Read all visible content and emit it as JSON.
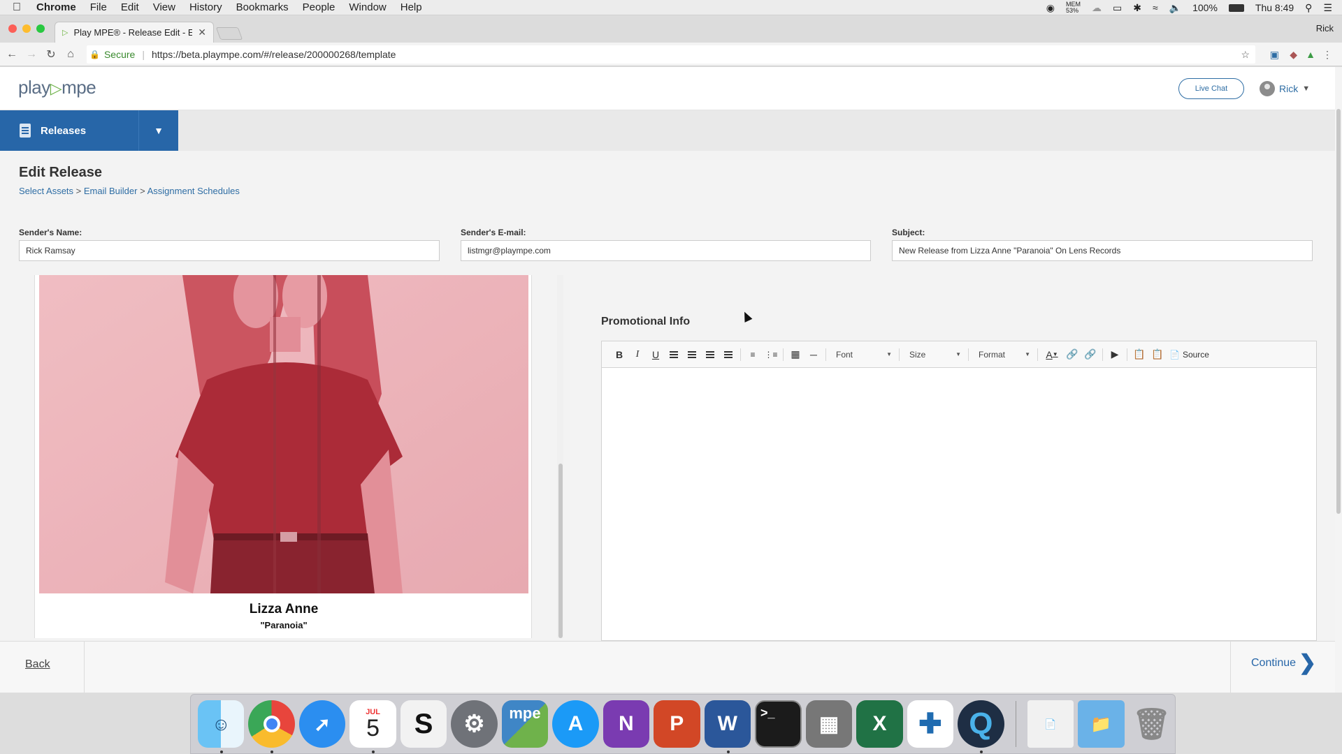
{
  "menubar": {
    "app": "Chrome",
    "items": [
      "File",
      "Edit",
      "View",
      "History",
      "Bookmarks",
      "People",
      "Window",
      "Help"
    ],
    "mem_label": "MEM",
    "mem_value": "53%",
    "battery": "100%",
    "clock": "Thu 8:49"
  },
  "browser": {
    "tab_title": "Play MPE® - Release Edit - Em",
    "profile_name": "Rick",
    "secure_label": "Secure",
    "url": "https://beta.plaympe.com/#/release/200000268/template"
  },
  "app": {
    "logo_play": "play",
    "logo_mpe": "mpe",
    "live_chat": "Live Chat",
    "user_name": "Rick",
    "nav_releases": "Releases"
  },
  "page": {
    "title": "Edit Release",
    "breadcrumbs": [
      "Select Assets",
      "Email Builder",
      "Assignment Schedules"
    ],
    "sep": ">"
  },
  "form": {
    "sender_name_label": "Sender's Name:",
    "sender_name_value": "Rick Ramsay",
    "sender_email_label": "Sender's E-mail:",
    "sender_email_value": "listmgr@plaympe.com",
    "subject_label": "Subject:",
    "subject_value": "New Release from Lizza Anne \"Paranoia\" On Lens Records"
  },
  "preview": {
    "artist": "Lizza Anne",
    "song": "\"Paranoia\""
  },
  "editor": {
    "section_title": "Promotional Info",
    "bold": "B",
    "italic": "I",
    "underline": "U",
    "font_label": "Font",
    "size_label": "Size",
    "format_label": "Format",
    "text_color": "A",
    "source_label": "Source"
  },
  "footer": {
    "back": "Back",
    "continue": "Continue"
  },
  "dock": {
    "calendar_month": "JUL",
    "calendar_day": "5",
    "mpe_label": "mpe",
    "terminal_prompt": ">_"
  },
  "colors": {
    "primary_blue": "#2766a8",
    "link_blue": "#2e6da4",
    "logo_green": "#6fb24b"
  }
}
